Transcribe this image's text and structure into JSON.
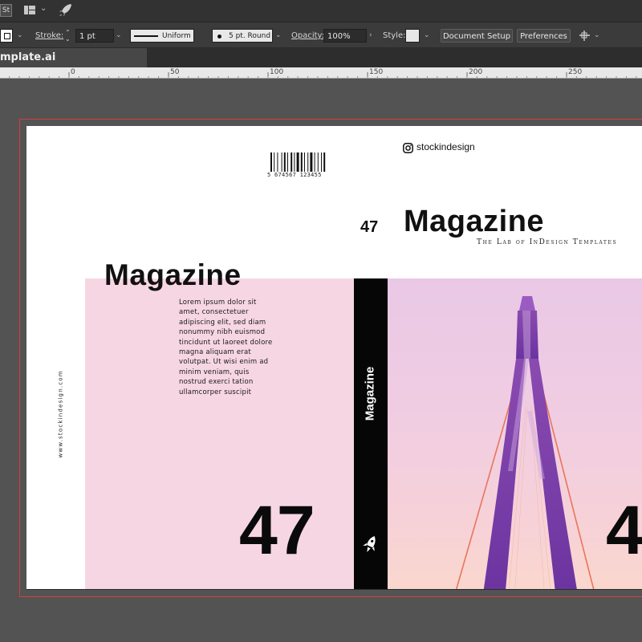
{
  "appbar": {
    "bridge_badge": "St",
    "layout_icon": "workspace-layout-icon",
    "rocket_icon": "gpu-performance-rocket-icon"
  },
  "control_bar": {
    "stroke_label": "Stroke:",
    "stroke_weight": "1 pt",
    "profile_label": "Uniform",
    "brush_label": "5 pt. Round",
    "opacity_label": "Opacity:",
    "opacity_value": "100%",
    "style_label": "Style:",
    "document_setup": "Document Setup",
    "preferences": "Preferences"
  },
  "tab": {
    "title": "mplate.ai"
  },
  "ruler": {
    "ticks": [
      "0",
      "50",
      "100",
      "150",
      "200",
      "250"
    ]
  },
  "cover": {
    "barcode_number": "5 674567 123455",
    "instagram_handle": "stockindesign",
    "issue_small": "47",
    "front_title": "Magazine",
    "front_tagline": "The Lab of InDesign Templates",
    "back_title": "Magazine",
    "lorem_lines": [
      "Lorem ipsum dolor sit",
      "amet, consectetuer",
      "adipiscing elit, sed diam",
      "nonummy nibh euismod",
      "tincidunt ut laoreet dolore",
      "magna aliquam erat",
      "volutpat. Ut wisi enim ad",
      "minim veniam, quis",
      "nostrud exerci tation",
      "ullamcorper suscipit"
    ],
    "vertical_url": "www.stockindesign.com",
    "back_issue": "47",
    "spine_title": "Magazine",
    "front_issue": "4"
  },
  "colors": {
    "pink_panel": "#f7d6e3",
    "spine": "#060606",
    "bleed_guide": "#d63c3c"
  }
}
